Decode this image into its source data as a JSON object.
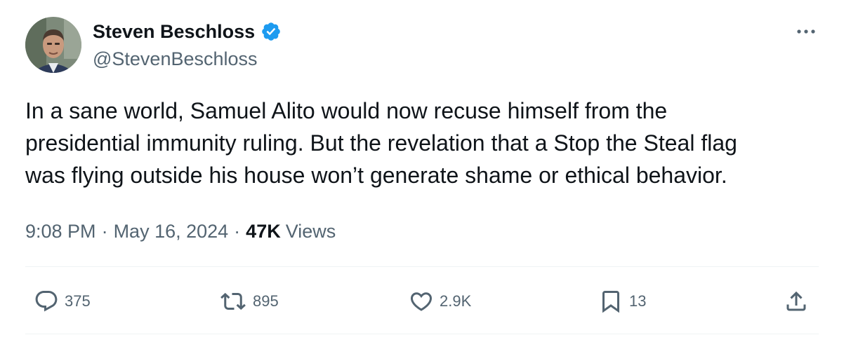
{
  "author": {
    "display_name": "Steven Beschloss",
    "handle": "@StevenBeschloss",
    "verified": true,
    "verified_color": "#1d9bf0"
  },
  "tweet": {
    "text": "In a sane world, Samuel Alito would now recuse himself from the\npresidential immunity ruling. But the revelation that a Stop the Steal flag\nwas flying outside his house won’t generate shame or ethical behavior."
  },
  "meta": {
    "time": "9:08 PM",
    "separator": "·",
    "date": "May 16, 2024",
    "views_count": "47K",
    "views_label": "Views"
  },
  "actions": {
    "replies": "375",
    "reposts": "895",
    "likes": "2.9K",
    "bookmarks": "13"
  },
  "icons": {
    "more": "more-icon",
    "reply": "reply-icon",
    "repost": "repost-icon",
    "like": "heart-icon",
    "bookmark": "bookmark-icon",
    "share": "share-icon"
  },
  "colors": {
    "text_primary": "#0f1419",
    "text_secondary": "#536471",
    "divider": "#eff3f4"
  }
}
